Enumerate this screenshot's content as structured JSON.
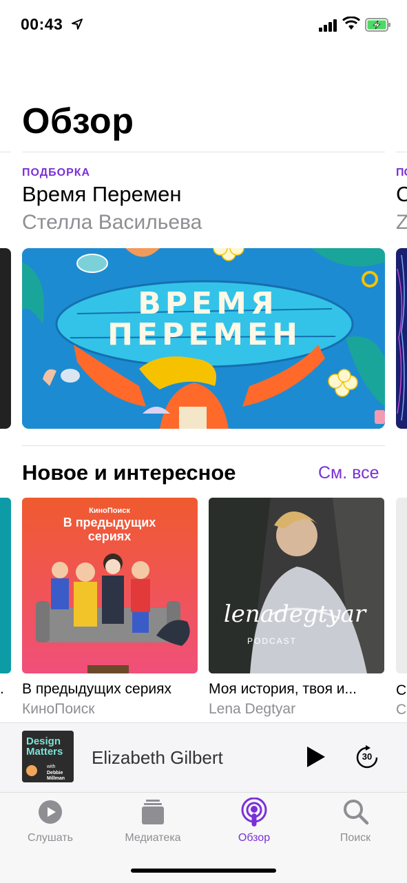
{
  "status_bar": {
    "time": "00:43"
  },
  "page": {
    "title": "Обзор"
  },
  "featured": {
    "label": "ПОДБОРКА",
    "title": "Время Перемен",
    "subtitle": "Стелла Васильева",
    "banner_text_line1": "ВРЕМЯ",
    "banner_text_line2": "ПЕРЕМЕН",
    "peek_label": "ПО",
    "peek_title": "С",
    "peek_sub": "Z"
  },
  "section": {
    "title": "Новое и интересное",
    "see_all": "См. все",
    "cards": [
      {
        "title": "В предыдущих сериях",
        "subtitle": "КиноПоиск",
        "art_brand": "КиноПоиск",
        "art_title": "В предыдущих сериях"
      },
      {
        "title": "Моя история, твоя и...",
        "subtitle": "Lena Degtyar",
        "art_script": "lenadegtyar",
        "art_tag": "PODCAST"
      }
    ],
    "peek_left_title": ".",
    "peek_right_title": "С",
    "peek_right_sub": "С"
  },
  "mini_player": {
    "title": "Elizabeth Gilbert",
    "art_title": "Design Matters",
    "art_sub": "with Debbie Millman",
    "skip_label": "30"
  },
  "tabs": [
    {
      "label": "Слушать",
      "icon": "play-circle-icon",
      "active": false
    },
    {
      "label": "Медиатека",
      "icon": "library-icon",
      "active": false
    },
    {
      "label": "Обзор",
      "icon": "podcast-icon",
      "active": true
    },
    {
      "label": "Поиск",
      "icon": "search-icon",
      "active": false
    }
  ],
  "colors": {
    "accent": "#7b2fd6",
    "gray": "#8e8e93",
    "banner": "#1d8bd1",
    "card1": "#ef5a3a"
  }
}
